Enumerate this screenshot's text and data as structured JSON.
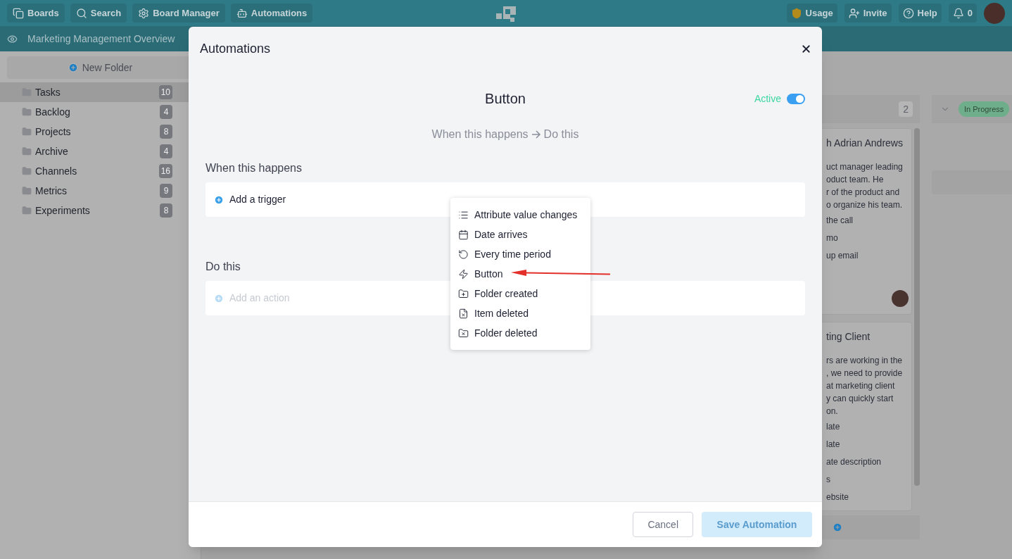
{
  "top_bar": {
    "nav": [
      {
        "label": "Boards"
      },
      {
        "label": "Search"
      },
      {
        "label": "Board Manager"
      },
      {
        "label": "Automations"
      }
    ],
    "right": [
      {
        "label": "Usage"
      },
      {
        "label": "Invite"
      },
      {
        "label": "Help"
      },
      {
        "label": "0"
      }
    ]
  },
  "board_title": "Marketing Management Overview",
  "sidebar": {
    "new_folder": "New Folder",
    "folders": [
      {
        "name": "Tasks",
        "count": "10",
        "selected": true
      },
      {
        "name": "Backlog",
        "count": "4",
        "selected": false
      },
      {
        "name": "Projects",
        "count": "8",
        "selected": false
      },
      {
        "name": "Archive",
        "count": "4",
        "selected": false
      },
      {
        "name": "Channels",
        "count": "16",
        "selected": false
      },
      {
        "name": "Metrics",
        "count": "9",
        "selected": false
      },
      {
        "name": "Experiments",
        "count": "8",
        "selected": false
      }
    ]
  },
  "board": {
    "columns": [
      {
        "count": "2",
        "cards": [
          {
            "title": "h Adrian Andrews",
            "description": [
              "uct manager leading",
              "oduct team. He",
              "r of the product and",
              "o organize his team."
            ],
            "checklist": [
              "the call",
              "mo",
              "up email"
            ],
            "avatar": true
          },
          {
            "title": "ting Client",
            "description": [
              "rs are working in the",
              ", we need to provide",
              "at marketing client",
              "y can quickly start",
              "on."
            ],
            "checklist": [
              "late",
              "late",
              "ate description",
              "s",
              "ebsite"
            ],
            "avatar": false
          }
        ]
      },
      {
        "status": "In Progress",
        "color": "#6fae8a"
      }
    ]
  },
  "modal": {
    "title": "Automations",
    "automation_name": "Button",
    "active": {
      "label": "Active",
      "on": true
    },
    "flow": {
      "from": "When this happens",
      "to": "Do this"
    },
    "trigger_section": {
      "heading": "When this happens",
      "button": {
        "label": "Add a trigger",
        "disabled": false
      }
    },
    "action_section": {
      "heading": "Do this",
      "button": {
        "label": "Add an action",
        "disabled": true
      }
    },
    "trigger_menu": [
      {
        "label": "Attribute value changes",
        "pointed": false
      },
      {
        "label": "Date arrives",
        "pointed": false
      },
      {
        "label": "Every time period",
        "pointed": false
      },
      {
        "label": "Button",
        "pointed": true
      },
      {
        "label": "Folder created",
        "pointed": false
      },
      {
        "label": "Item deleted",
        "pointed": false
      },
      {
        "label": "Folder deleted",
        "pointed": false
      }
    ],
    "footer": {
      "cancel": "Cancel",
      "save": {
        "label": "Save Automation",
        "disabled": true
      }
    }
  }
}
